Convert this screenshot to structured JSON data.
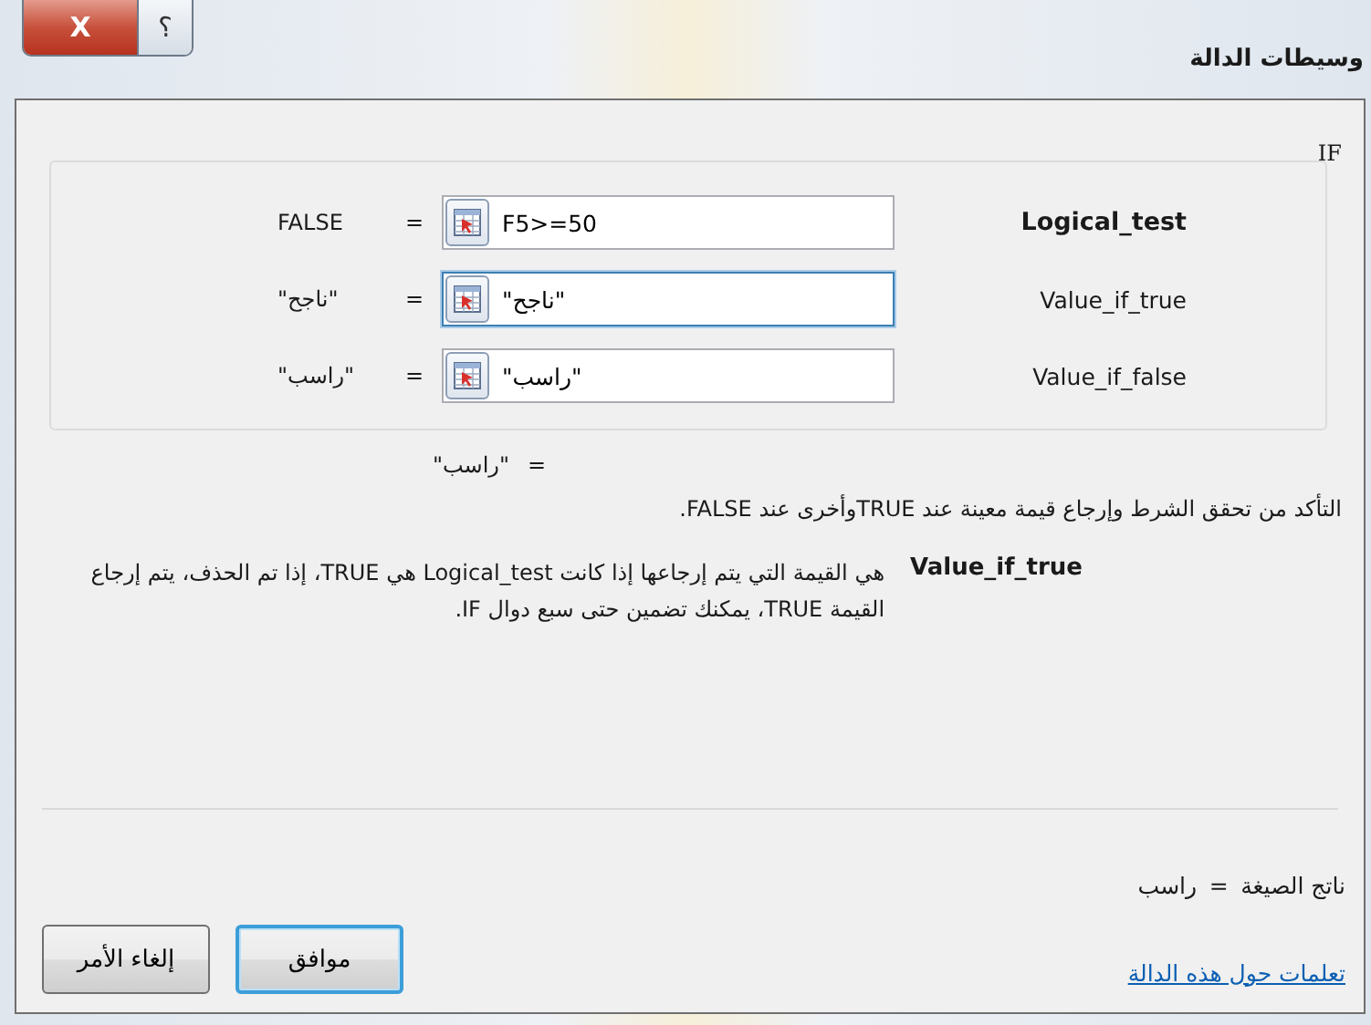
{
  "window": {
    "title": "وسيطات الدالة",
    "buttons": [
      {
        "kind": "help",
        "label": "؟"
      },
      {
        "kind": "close",
        "label": "X"
      }
    ]
  },
  "function": {
    "name": "IF",
    "arguments": [
      {
        "label": "Logical_test",
        "required": true,
        "value": "F5>=50",
        "result": "FALSE",
        "focused": false
      },
      {
        "label": "Value_if_true",
        "required": false,
        "value": "\"ناجح\"",
        "result": "\"ناجح\"",
        "focused": true
      },
      {
        "label": "Value_if_false",
        "required": false,
        "value": "\"راسب\"",
        "result": "\"راسب\"",
        "focused": false
      }
    ],
    "equals": [
      "=",
      "=",
      "="
    ],
    "result": {
      "sign": "=",
      "value": "\"راسب\""
    },
    "description": "التأكد من تحقق الشرط وإرجاع قيمة معينة عند TRUEوأخرى عند FALSE.",
    "argument_help": {
      "name": "Value_if_true",
      "text": "هي القيمة التي يتم إرجاعها إذا كانت Logical_test هي TRUE، إذا تم الحذف، يتم إرجاع القيمة TRUE، يمكنك تضمين حتى سبع دوال IF."
    }
  },
  "formula_result": {
    "label": "ناتج الصيغة",
    "sign": "=",
    "value": "راسب"
  },
  "help_link": "تعلمات حول هذه الدالة",
  "buttons": [
    {
      "label": "موافق",
      "default": true
    },
    {
      "label": "إلغاء الأمر",
      "default": false
    }
  ]
}
